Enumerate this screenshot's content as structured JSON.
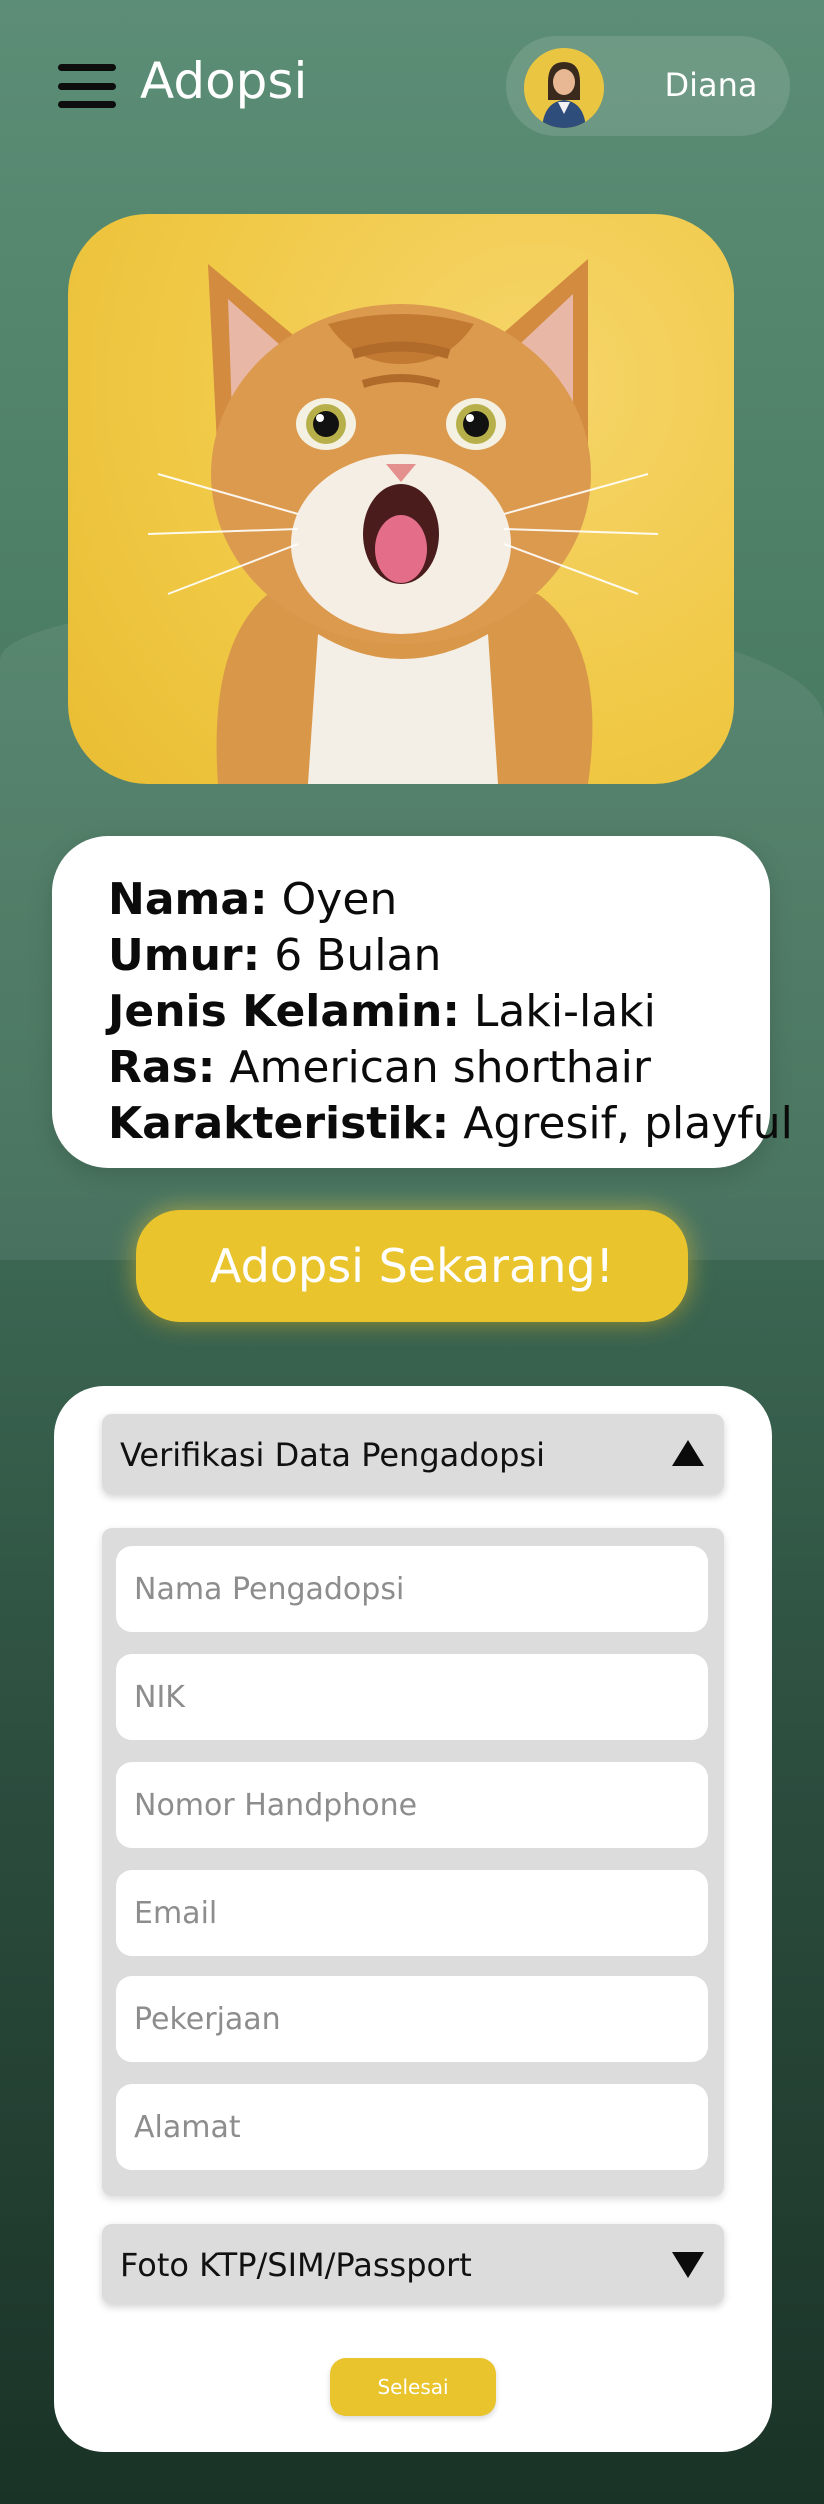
{
  "header": {
    "title": "Adopsi",
    "menu_icon": "hamburger-menu-icon",
    "user_name": "Diana"
  },
  "pet": {
    "photo": "cat-photo",
    "fields": [
      {
        "label": "Nama:",
        "value": "Oyen"
      },
      {
        "label": "Umur:",
        "value": "6 Bulan"
      },
      {
        "label": "Jenis Kelamin:",
        "value": "Laki-laki"
      },
      {
        "label": "Ras:",
        "value": "American shorthair"
      },
      {
        "label": "Karakteristik:",
        "value": "Agresif, playful"
      }
    ]
  },
  "adopt_button": "Adopsi Sekarang!",
  "form": {
    "verification_title": "Verifikasi Data Pengadopsi",
    "fields": [
      {
        "placeholder": "Nama Pengadopsi"
      },
      {
        "placeholder": "NIK"
      },
      {
        "placeholder": "Nomor Handphone"
      },
      {
        "placeholder": "Email"
      },
      {
        "placeholder": "Pekerjaan"
      },
      {
        "placeholder": "Alamat"
      }
    ],
    "id_photo_title": "Foto KTP/SIM/Passport",
    "submit_label": "Selesai"
  },
  "colors": {
    "accent": "#e9c42c",
    "background_top": "#5c8d76",
    "background_bottom": "#1e3a2d",
    "card": "#ffffff",
    "panel": "#dcdcdc"
  }
}
